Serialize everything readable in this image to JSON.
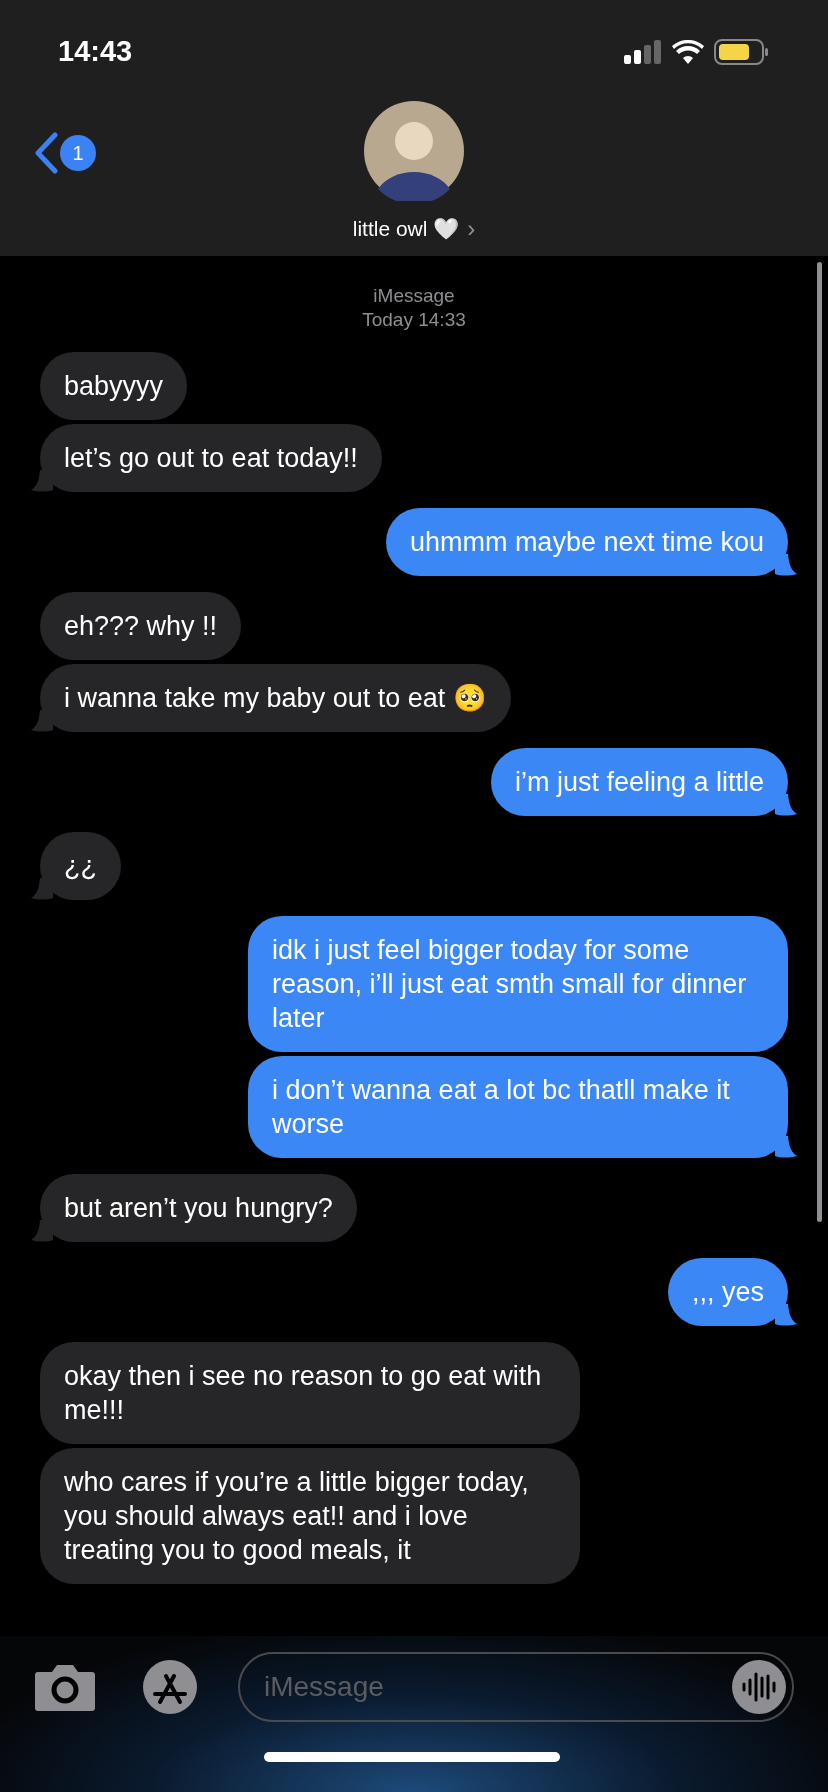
{
  "status_bar": {
    "time": "14:43"
  },
  "header": {
    "unread_count": "1",
    "contact_name": "little owl 🤍",
    "chevron": "›"
  },
  "thread_info": {
    "service": "iMessage",
    "timestamp": "Today 14:33"
  },
  "messages": [
    {
      "kind": "incoming",
      "text": "babyyyy",
      "tail": false
    },
    {
      "kind": "incoming",
      "text": "let’s go out to eat today!!",
      "tail": true
    },
    {
      "kind": "outgoing",
      "text": "uhmmm maybe next time kou",
      "tail": true
    },
    {
      "kind": "incoming",
      "text": "eh??? why !!",
      "tail": false
    },
    {
      "kind": "incoming",
      "text": "i wanna take my baby out to eat 🥺",
      "tail": true
    },
    {
      "kind": "outgoing",
      "text": "i’m just feeling a little",
      "tail": true
    },
    {
      "kind": "incoming",
      "text": "¿¿",
      "tail": true
    },
    {
      "kind": "outgoing",
      "text": "idk i just feel bigger today for some reason, i’ll just eat smth small for dinner later",
      "tail": false
    },
    {
      "kind": "outgoing",
      "text": "i don’t wanna eat a lot bc thatll make it worse",
      "tail": true
    },
    {
      "kind": "incoming",
      "text": "but aren’t you hungry?",
      "tail": true
    },
    {
      "kind": "outgoing",
      "text": ",,, yes",
      "tail": true
    },
    {
      "kind": "incoming",
      "text": "okay then i see no reason to go eat with me!!!",
      "tail": false
    },
    {
      "kind": "incoming",
      "text": "who cares if you’re a little bigger today, you should always eat!! and i love treating you to good meals, it",
      "tail": false
    }
  ],
  "composer": {
    "placeholder": "iMessage"
  }
}
